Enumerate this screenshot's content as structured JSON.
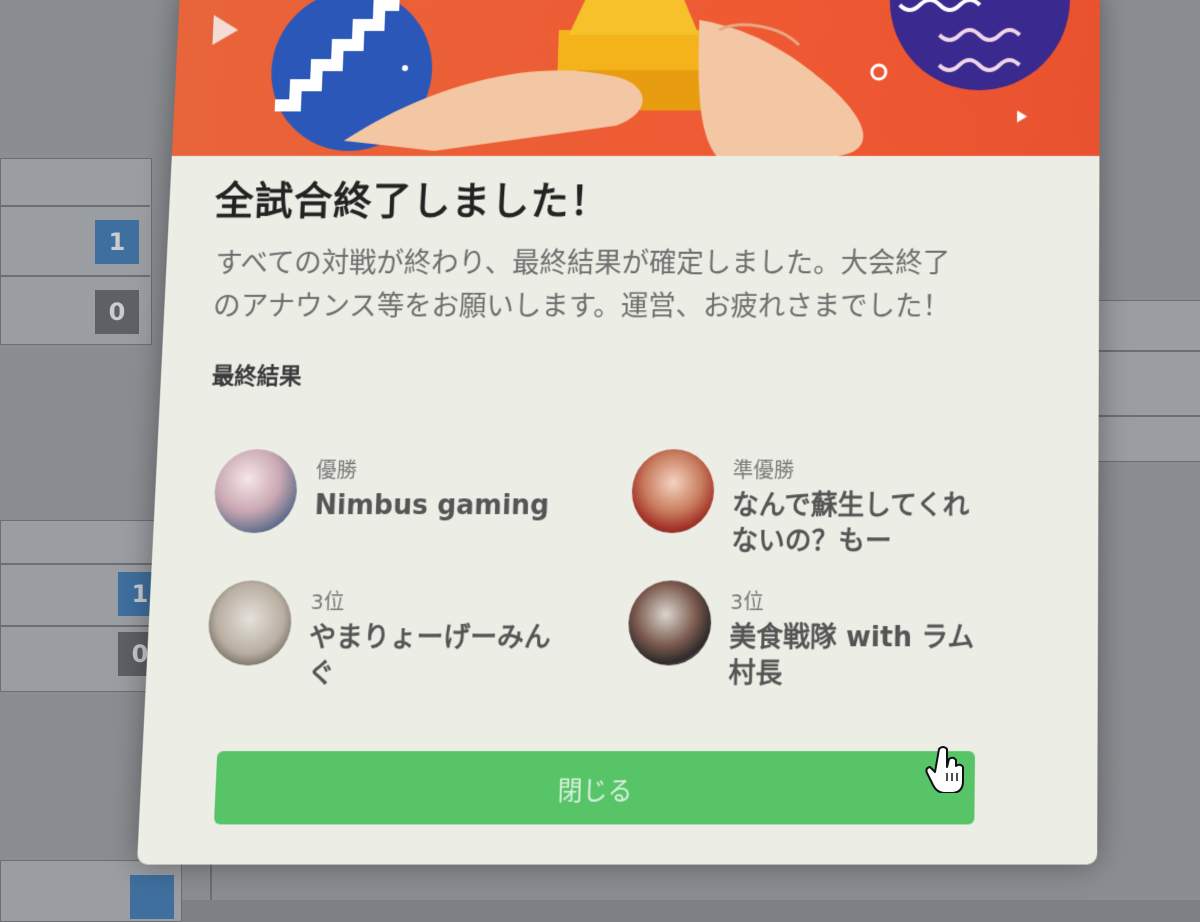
{
  "background": {
    "scores": [
      "1",
      "0",
      "1",
      "0"
    ]
  },
  "modal": {
    "title": "全試合終了しました！",
    "description": "すべての対戦が終わり、最終結果が確定しました。大会終了\nのアナウンス等をお願いします。運営、お疲れさまでした！",
    "section_label": "最終結果",
    "results": [
      {
        "rank": "優勝",
        "name": "Nimbus gaming"
      },
      {
        "rank": "準優勝",
        "name": "なんで蘇生してくれ\nないの？もー"
      },
      {
        "rank": "3位",
        "name": "やまりょーげーみん\nぐ"
      },
      {
        "rank": "3位",
        "name": "美食戦隊 with ラム\n村長"
      }
    ],
    "close_label": "閉じる"
  },
  "colors": {
    "banner": "#ef5a33",
    "button": "#57c468",
    "modal_bg": "#eceee6"
  }
}
